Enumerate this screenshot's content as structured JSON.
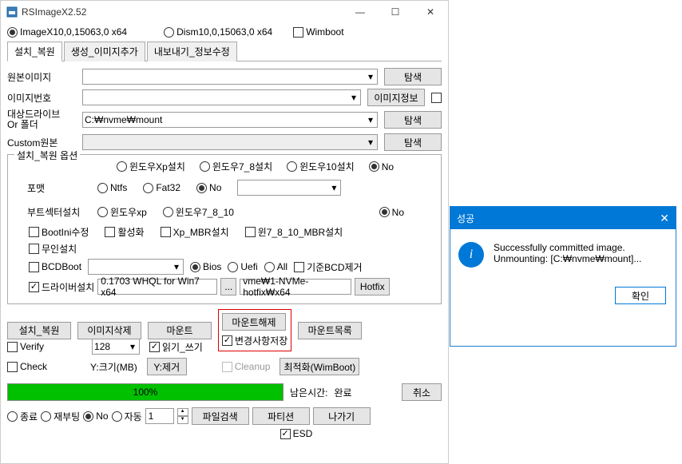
{
  "mainWindow": {
    "title": "RSImageX2.52",
    "topRadios": {
      "imagex": "ImageX10,0,15063,0 x64",
      "dism": "Dism10,0,15063,0 x64",
      "wimboot": "Wimboot"
    },
    "tabs": {
      "install": "설치_복원",
      "create": "생성_이미지추가",
      "export": "내보내기_정보수정"
    },
    "labels": {
      "sourceImage": "원본이미지",
      "imageNumber": "이미지번호",
      "targetDrive": "대상드라이브\nOr 폴더",
      "customSource": "Custom원본",
      "format": "포맷",
      "bootSector": "부트섹터설치",
      "remaining": "남은시간:",
      "ySize": "Y:크기(MB)"
    },
    "buttons": {
      "browse": "탐색",
      "imageInfo": "이미지정보",
      "install": "설치_복원",
      "deleteImage": "이미지삭제",
      "mount": "마운트",
      "unmount": "마운트해제",
      "mountList": "마운트목록",
      "hotfix": "Hotfix",
      "cancel": "취소",
      "fileSearch": "파일검색",
      "partition": "파티션",
      "exit": "나가기",
      "optimize": "최적화(WimBoot)",
      "dots": "...",
      "yDelete": "Y:제거"
    },
    "fieldset": {
      "legend": "설치_복원 옵션",
      "winOpts": {
        "xp": "윈도우Xp설치",
        "w78": "윈도우7_8설치",
        "w10": "윈도우10설치",
        "no": "No"
      },
      "formatOpts": {
        "ntfs": "Ntfs",
        "fat32": "Fat32",
        "no": "No"
      },
      "bootOpts": {
        "xp": "윈도우xp",
        "w7810": "윈도우7_8_10",
        "no": "No"
      },
      "checks": {
        "bootini": "BootIni수정",
        "activate": "활성화",
        "xpmbr": "Xp_MBR설치",
        "w7810mbr": "윈7_8_10_MBR설치",
        "silent": "무인설치",
        "bcdboot": "BCDBoot",
        "defaultbcd": "기준BCD제거",
        "driver": "드라이버설치"
      },
      "biosOpts": {
        "bios": "Bios",
        "uefi": "Uefi",
        "all": "All"
      },
      "driverText1": "0.1703 WHQL for Win7 x64",
      "driverText2": "vme₩1-NVMe-hotfix₩x64"
    },
    "targetPath": "C:₩nvme₩mount",
    "bottomChecks": {
      "verify": "Verify",
      "check": "Check",
      "readwrite": "읽기_쓰기",
      "saveChanges": "변경사항저장",
      "cleanup": "Cleanup",
      "esd": "ESD"
    },
    "combo128": "128",
    "progress": {
      "pct": "100%",
      "remainVal": "완료"
    },
    "endOpts": {
      "shutdown": "종료",
      "reboot": "재부팅",
      "no": "No",
      "auto": "자동",
      "spinVal": "1"
    }
  },
  "dialog": {
    "title": "성공",
    "msg1": "Successfully committed image.",
    "msg2": "Unmounting: [C:₩nvme₩mount]...",
    "ok": "확인"
  }
}
